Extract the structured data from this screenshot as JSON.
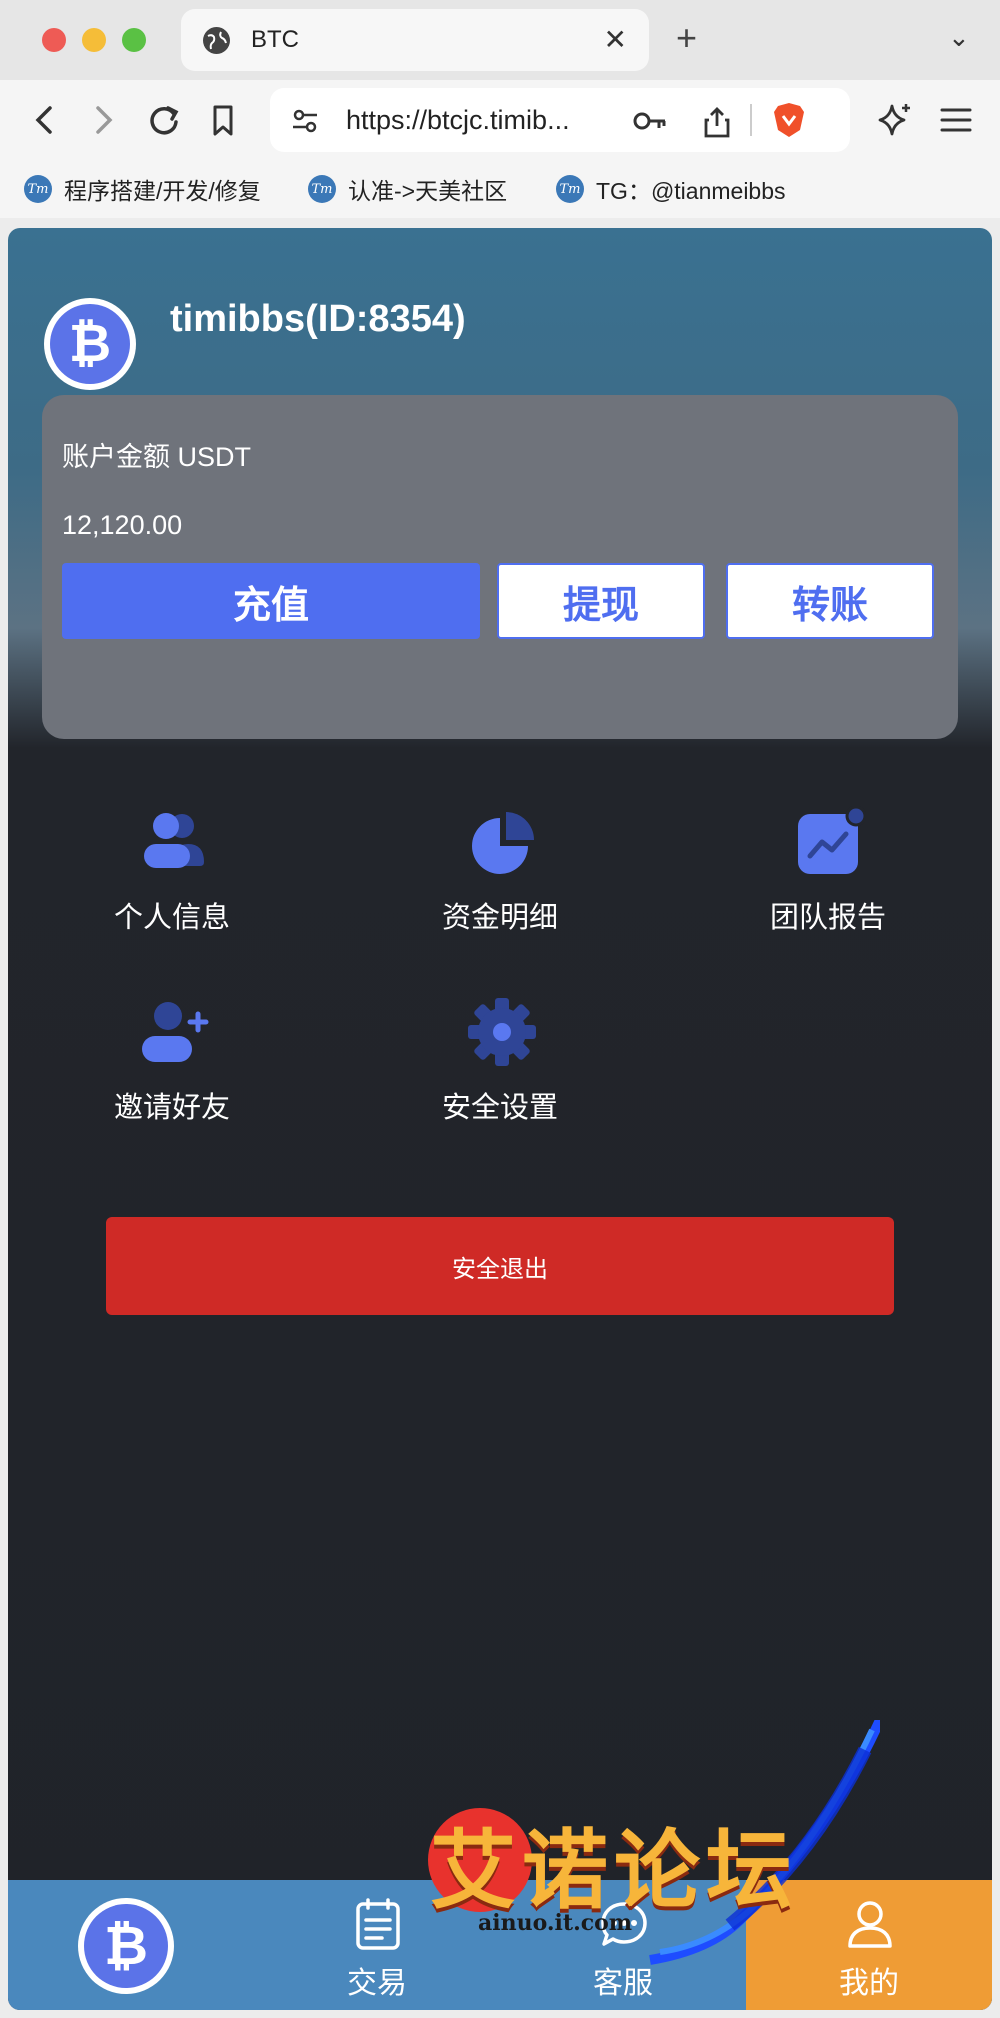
{
  "browser": {
    "tab_title": "BTC",
    "url": "https://btcjc.timib...",
    "bookmarks": [
      {
        "logo": "Tm",
        "label": "程序搭建/开发/修复"
      },
      {
        "logo": "Tm",
        "label": "认准->天美社区"
      },
      {
        "logo": "Tm",
        "label": "TG：@tianmeibbs"
      }
    ]
  },
  "profile": {
    "avatar_glyph": "₿",
    "username": "timibbs(ID:8354)"
  },
  "account": {
    "label": "账户金额 USDT",
    "amount": "12,120.00",
    "buttons": {
      "recharge": "充值",
      "withdraw": "提现",
      "transfer": "转账"
    }
  },
  "menu": [
    {
      "icon": "user-group-icon",
      "label": "个人信息"
    },
    {
      "icon": "pie-chart-icon",
      "label": "资金明细"
    },
    {
      "icon": "trend-chart-icon",
      "label": "团队报告"
    },
    {
      "icon": "user-add-icon",
      "label": "邀请好友"
    },
    {
      "icon": "gear-icon",
      "label": "安全设置"
    }
  ],
  "logout_label": "安全退出",
  "bottom_nav": [
    {
      "icon": "bitcoin-icon",
      "label": ""
    },
    {
      "icon": "document-icon",
      "label": "交易"
    },
    {
      "icon": "chat-icon",
      "label": "客服"
    },
    {
      "icon": "user-icon",
      "label": "我的"
    }
  ],
  "colors": {
    "accent": "#4f6ef0",
    "danger": "#cf2a26",
    "nav_bar": "#4a88bd",
    "nav_active": "#ef9c35"
  },
  "watermark": {
    "title": "艾诺论坛",
    "subtitle": "ainuo.it.com"
  }
}
